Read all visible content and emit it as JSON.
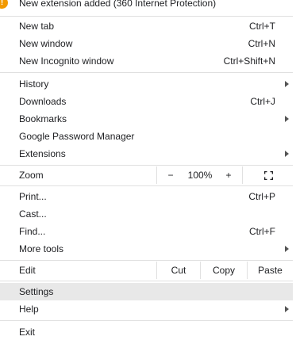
{
  "notice": {
    "icon": "warning-icon",
    "icon_glyph": "!",
    "label": "New extension added (360 Internet Protection)"
  },
  "items": {
    "new_tab": {
      "label": "New tab",
      "shortcut": "Ctrl+T"
    },
    "new_window": {
      "label": "New window",
      "shortcut": "Ctrl+N"
    },
    "new_incognito": {
      "label": "New Incognito window",
      "shortcut": "Ctrl+Shift+N"
    },
    "history": {
      "label": "History"
    },
    "downloads": {
      "label": "Downloads",
      "shortcut": "Ctrl+J"
    },
    "bookmarks": {
      "label": "Bookmarks"
    },
    "password_manager": {
      "label": "Google Password Manager"
    },
    "extensions": {
      "label": "Extensions"
    },
    "print": {
      "label": "Print...",
      "shortcut": "Ctrl+P"
    },
    "cast": {
      "label": "Cast..."
    },
    "find": {
      "label": "Find...",
      "shortcut": "Ctrl+F"
    },
    "more_tools": {
      "label": "More tools"
    },
    "settings": {
      "label": "Settings"
    },
    "help": {
      "label": "Help"
    },
    "exit": {
      "label": "Exit"
    }
  },
  "zoom": {
    "label": "Zoom",
    "minus": "−",
    "level": "100%",
    "plus": "+",
    "fullscreen_icon": "fullscreen-icon"
  },
  "edit": {
    "label": "Edit",
    "cut": "Cut",
    "copy": "Copy",
    "paste": "Paste"
  },
  "colors": {
    "highlight": "#e8e8e8",
    "warning": "#f29900",
    "separator": "#e0e0e0"
  }
}
